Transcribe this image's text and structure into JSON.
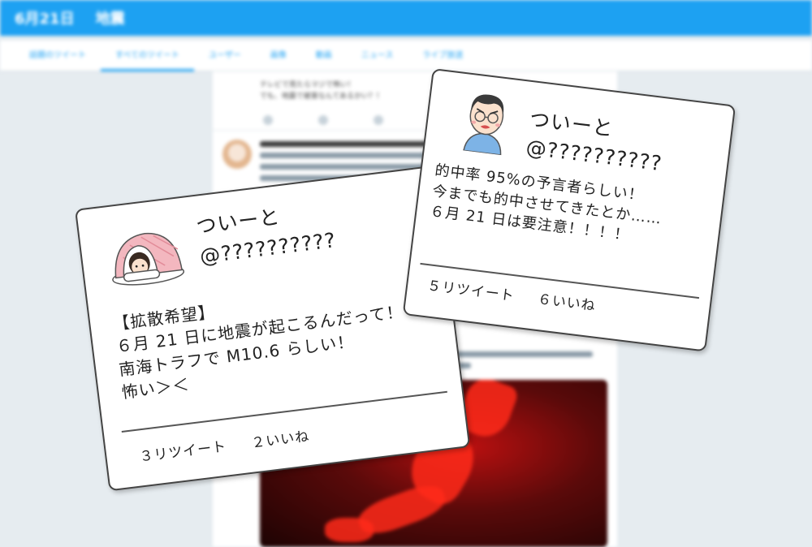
{
  "topbar": {
    "date": "6月21日",
    "title": "地震",
    "color": "#1da1f2"
  },
  "tabs": [
    "話題のツイート",
    "すべてのツイート",
    "ユーザー",
    "画像",
    "動画",
    "ニュース",
    "ライブ放送"
  ],
  "background_tweet": {
    "line1": "テレビで見たらマジで怖い！",
    "line2": "でも、地震で被害なんてあるかい？！"
  },
  "card_left": {
    "name": "ついーと",
    "handle": "@??????????",
    "body": [
      "【拡散希望】",
      "６月 21 日に地震が起こるんだって！",
      "南海トラフで M10.6 らしい！",
      "怖い＞＜"
    ],
    "retweets": "３リツイート",
    "likes": "２いいね"
  },
  "card_right": {
    "name": "ついーと",
    "handle": "@??????????",
    "body": [
      "的中率 95%の予言者らしい！",
      "今までも的中させてきたとか……",
      "６月 21 日は要注意！！！！"
    ],
    "retweets": "５リツイート",
    "likes": "６いいね"
  }
}
